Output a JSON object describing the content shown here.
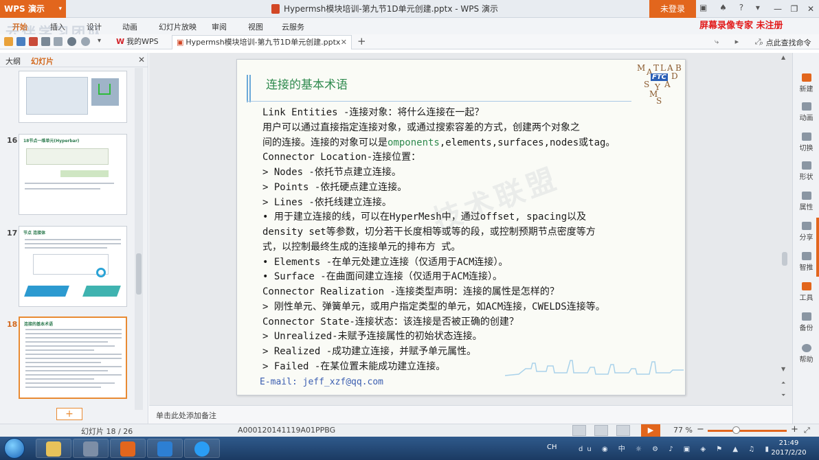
{
  "app": {
    "wps_button": "WPS 演示",
    "window_title": "Hypermsh模块培训-第九节1D单元创建.pptx - WPS 演示",
    "login_label": "未登录",
    "recorder_label": "屏幕录像专家 未注册",
    "watermark_top": "云伴学习团队"
  },
  "menu": {
    "items": [
      "开始",
      "插入",
      "设计",
      "动画",
      "幻灯片放映",
      "审阅",
      "视图",
      "云服务"
    ]
  },
  "tabs": {
    "mywps": "我的WPS",
    "doc": "Hypermsh模块培训-第九节1D单元创建.pptx",
    "help_cmd": "点此查找命令"
  },
  "left_panel": {
    "tab_outline": "大纲",
    "tab_slides": "幻灯片",
    "slide_numbers": [
      "16",
      "17",
      "18"
    ],
    "thumb16_title": "18节点一维单元(Hyperbar)",
    "thumb17_title": "节点 连接体",
    "thumb18_title": "连接的基本术语"
  },
  "slide": {
    "title": "连接的基本术语",
    "lines": [
      "Link Entities -连接对象：将什么连接在一起？",
      "用户可以通过直接指定连接对象，或通过搜索容差的方式，创建两个对象之",
      "间的连接。连接的对象可以是",
      "omponents",
      ",elements,surfaces,nodes或tag。",
      "Connector Location-连接位置：",
      "> Nodes -依托节点建立连接。",
      "> Points -依托硬点建立连接。",
      "> Lines -依托线建立连接。",
      "• 用于建立连接的线，可以在HyperMesh中，通过offset, spacing以及",
      "density set等参数，切分若干长度相等或等的段，或控制预期节点密度等方",
      "式，以控制最终生成的连接单元的排布方 式。",
      "• Elements -在单元处建立连接（仅适用于ACM连接）。",
      "• Surface -在曲面间建立连接（仅适用于ACM连接）。",
      "Connector Realization -连接类型声明：连接的属性是怎样的？",
      "> 刚性单元、弹簧单元，或用户指定类型的单元，如ACM连接，CWELDS连接等。",
      "Connector State-连接状态：该连接是否被正确的创建？",
      "> Unrealized-未赋予连接属性的初始状态连接。",
      "> Realized -成功建立连接，并赋予单元属性。",
      "> Failed -在某位置未能成功建立连接。"
    ],
    "email": "E-mail: jeff_xzf@qq.com",
    "watermark": "技术联盟",
    "logo": {
      "M": "M",
      "A": "A",
      "T": "T",
      "L": "L",
      "A2": "A",
      "B": "B",
      "FTC": "FTC",
      "D": "D",
      "S": "S",
      "Y": "Y",
      "M2": "M",
      "A3": "A",
      "S2": "S"
    }
  },
  "notes_placeholder": "单击此处添加备注",
  "right_bar": [
    "新建",
    "动画",
    "切换",
    "形状",
    "属性",
    "分享",
    "智推",
    "工具",
    "备份",
    "帮助"
  ],
  "status": {
    "slide_counter": "幻灯片 18 / 26",
    "template": "A000120141119A01PPBG",
    "zoom": "77 %"
  },
  "taskbar": {
    "tray_text": "CH",
    "time": "21:49",
    "date": "2017/2/20"
  },
  "colors": {
    "accent": "#e2661d",
    "slide_title": "#2f8a4e",
    "email": "#3a5db0"
  }
}
